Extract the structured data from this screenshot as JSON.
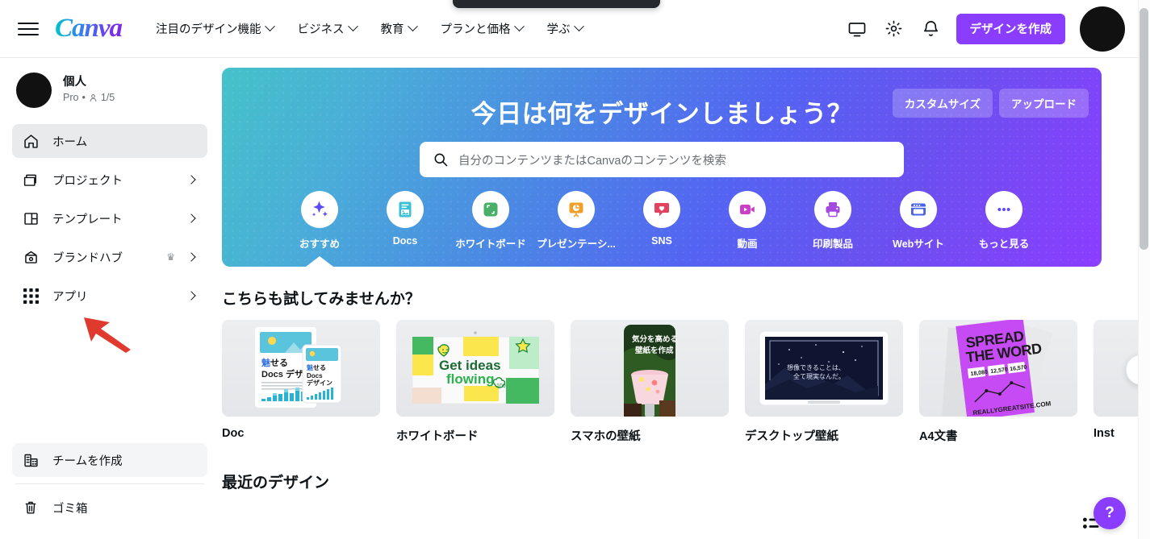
{
  "tooltip": {
    "visible": true
  },
  "header": {
    "menu_icon": "hamburger-icon",
    "logo_text": "Canva",
    "nav": [
      {
        "label": "注目のデザイン機能",
        "has_caret": true
      },
      {
        "label": "ビジネス",
        "has_caret": true
      },
      {
        "label": "教育",
        "has_caret": true
      },
      {
        "label": "プランと価格",
        "has_caret": true
      },
      {
        "label": "学ぶ",
        "has_caret": true
      }
    ],
    "icons": [
      "monitor-icon",
      "gear-icon",
      "bell-icon"
    ],
    "create_button": "デザインを作成",
    "avatar": "user-avatar"
  },
  "sidebar": {
    "profile": {
      "name": "個人",
      "plan": "Pro",
      "separator": "•",
      "seats": "1/5"
    },
    "items": [
      {
        "label": "ホーム",
        "icon": "home-icon",
        "active": true,
        "chevron": false,
        "crown": false
      },
      {
        "label": "プロジェクト",
        "icon": "folder-icon",
        "active": false,
        "chevron": true,
        "crown": false
      },
      {
        "label": "テンプレート",
        "icon": "template-icon",
        "active": false,
        "chevron": true,
        "crown": false
      },
      {
        "label": "ブランドハブ",
        "icon": "brand-icon",
        "active": false,
        "chevron": true,
        "crown": true
      },
      {
        "label": "アプリ",
        "icon": "apps-grid-icon",
        "active": false,
        "chevron": true,
        "crown": false
      }
    ],
    "bottom_items": [
      {
        "label": "チームを作成",
        "icon": "team-icon",
        "highlighted": true
      },
      {
        "label": "ゴミ箱",
        "icon": "trash-icon",
        "highlighted": false
      }
    ],
    "annotation": {
      "type": "red-arrow",
      "points_to": "アプリ"
    }
  },
  "hero": {
    "title": "今日は何をデザインしましょう？",
    "custom_size_button": "カスタムサイズ",
    "upload_button": "アップロード",
    "search": {
      "icon": "search-icon",
      "placeholder": "自分のコンテンツまたはCanvaのコンテンツを検索",
      "value": ""
    },
    "categories": [
      {
        "label": "おすすめ",
        "icon": "sparkles-icon",
        "active": true
      },
      {
        "label": "Docs",
        "icon": "doc-icon",
        "active": false
      },
      {
        "label": "ホワイトボード",
        "icon": "whiteboard-icon",
        "active": false
      },
      {
        "label": "プレゼンテーシ...",
        "icon": "presentation-icon",
        "active": false
      },
      {
        "label": "SNS",
        "icon": "social-heart-icon",
        "active": false
      },
      {
        "label": "動画",
        "icon": "video-icon",
        "active": false
      },
      {
        "label": "印刷製品",
        "icon": "printer-icon",
        "active": false
      },
      {
        "label": "Webサイト",
        "icon": "website-icon",
        "active": false
      },
      {
        "label": "もっと見る",
        "icon": "more-dots-icon",
        "active": false
      }
    ],
    "gradient_from": "#45c2c9",
    "gradient_to": "#8b3dff"
  },
  "try_section": {
    "title": "こちらも試してみませんか？",
    "next_arrow": "chevron-right-icon",
    "cards": [
      {
        "label": "Doc",
        "thumb_title": "魅せる",
        "thumb_sub": "Docs デザイン"
      },
      {
        "label": "ホワイトボード",
        "thumb_title": "Get ideas",
        "thumb_sub": "flowing"
      },
      {
        "label": "スマホの壁紙",
        "thumb_title": "気分を高める",
        "thumb_sub": "壁紙を作成"
      },
      {
        "label": "デスクトップ壁紙",
        "thumb_title": "想像できることは、",
        "thumb_sub": "全て現実なんだ。"
      },
      {
        "label": "A4文書",
        "thumb_title": "SPREAD",
        "thumb_sub": "THE WORD"
      },
      {
        "label": "Inst",
        "thumb_title": "",
        "thumb_sub": ""
      }
    ]
  },
  "recent_section": {
    "title": "最近のデザイン",
    "view_toggle_icon": "list-view-icon"
  },
  "help": {
    "label": "?"
  },
  "scrollbar": {
    "position": "top"
  },
  "colors": {
    "brand_purple": "#8b3dff",
    "text": "#0d1216",
    "muted": "#6a6f75",
    "active_bg": "#e8eaec",
    "annotation_red": "#e0392e"
  }
}
